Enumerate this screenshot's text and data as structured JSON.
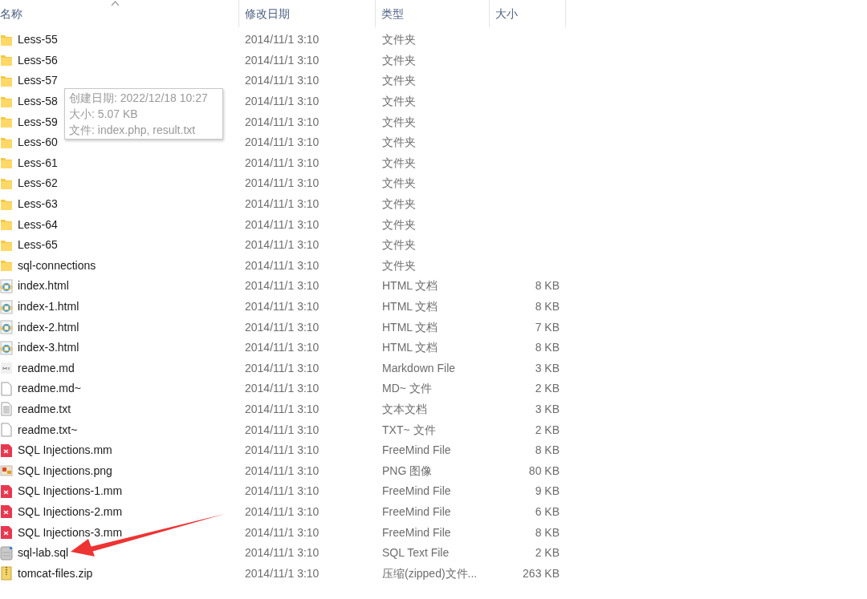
{
  "columns": [
    {
      "label": "名称",
      "sorted": true
    },
    {
      "label": "修改日期",
      "sorted": false
    },
    {
      "label": "类型",
      "sorted": false
    },
    {
      "label": "大小",
      "sorted": false
    }
  ],
  "rows": [
    {
      "kind": "folder",
      "name": "Less-55",
      "date": "2014/11/1 3:10",
      "type": "文件夹"
    },
    {
      "kind": "folder",
      "name": "Less-56",
      "date": "2014/11/1 3:10",
      "type": "文件夹"
    },
    {
      "kind": "folder",
      "name": "Less-57",
      "date": "2014/11/1 3:10",
      "type": "文件夹"
    },
    {
      "kind": "folder",
      "name": "Less-58",
      "date": "2014/11/1 3:10",
      "type": "文件夹"
    },
    {
      "kind": "folder",
      "name": "Less-59",
      "date": "2014/11/1 3:10",
      "type": "文件夹"
    },
    {
      "kind": "folder",
      "name": "Less-60",
      "date": "2014/11/1 3:10",
      "type": "文件夹"
    },
    {
      "kind": "folder",
      "name": "Less-61",
      "date": "2014/11/1 3:10",
      "type": "文件夹"
    },
    {
      "kind": "folder",
      "name": "Less-62",
      "date": "2014/11/1 3:10",
      "type": "文件夹"
    },
    {
      "kind": "folder",
      "name": "Less-63",
      "date": "2014/11/1 3:10",
      "type": "文件夹"
    },
    {
      "kind": "folder",
      "name": "Less-64",
      "date": "2014/11/1 3:10",
      "type": "文件夹"
    },
    {
      "kind": "folder",
      "name": "Less-65",
      "date": "2014/11/1 3:10",
      "type": "文件夹"
    },
    {
      "kind": "folder",
      "name": "sql-connections",
      "date": "2014/11/1 3:10",
      "type": "文件夹"
    },
    {
      "kind": "html",
      "name": "index.html",
      "date": "2014/11/1 3:10",
      "type": "HTML 文档",
      "size": "8 KB"
    },
    {
      "kind": "html",
      "name": "index-1.html",
      "date": "2014/11/1 3:10",
      "type": "HTML 文档",
      "size": "8 KB"
    },
    {
      "kind": "html",
      "name": "index-2.html",
      "date": "2014/11/1 3:10",
      "type": "HTML 文档",
      "size": "7 KB"
    },
    {
      "kind": "html",
      "name": "index-3.html",
      "date": "2014/11/1 3:10",
      "type": "HTML 文档",
      "size": "8 KB"
    },
    {
      "kind": "markdown",
      "name": "readme.md",
      "date": "2014/11/1 3:10",
      "type": "Markdown File",
      "size": "3 KB"
    },
    {
      "kind": "blank",
      "name": "readme.md~",
      "date": "2014/11/1 3:10",
      "type": "MD~ 文件",
      "size": "2 KB"
    },
    {
      "kind": "text",
      "name": "readme.txt",
      "date": "2014/11/1 3:10",
      "type": "文本文档",
      "size": "3 KB"
    },
    {
      "kind": "blank",
      "name": "readme.txt~",
      "date": "2014/11/1 3:10",
      "type": "TXT~ 文件",
      "size": "2 KB"
    },
    {
      "kind": "mindmap",
      "name": "SQL Injections.mm",
      "date": "2014/11/1 3:10",
      "type": "FreeMind File",
      "size": "8 KB"
    },
    {
      "kind": "image",
      "name": "SQL Injections.png",
      "date": "2014/11/1 3:10",
      "type": "PNG 图像",
      "size": "80 KB"
    },
    {
      "kind": "mindmap",
      "name": "SQL Injections-1.mm",
      "date": "2014/11/1 3:10",
      "type": "FreeMind File",
      "size": "9 KB"
    },
    {
      "kind": "mindmap",
      "name": "SQL Injections-2.mm",
      "date": "2014/11/1 3:10",
      "type": "FreeMind File",
      "size": "6 KB"
    },
    {
      "kind": "mindmap",
      "name": "SQL Injections-3.mm",
      "date": "2014/11/1 3:10",
      "type": "FreeMind File",
      "size": "8 KB"
    },
    {
      "kind": "sql",
      "name": "sql-lab.sql",
      "date": "2014/11/1 3:10",
      "type": "SQL Text File",
      "size": "2 KB"
    },
    {
      "kind": "zip",
      "name": "tomcat-files.zip",
      "date": "2014/11/1 3:10",
      "type": "压缩(zipped)文件...",
      "size": "263 KB"
    }
  ],
  "tooltip": {
    "lines": [
      "创建日期: 2022/12/18 10:27",
      "大小: 5.07 KB",
      "文件: index.php, result.txt"
    ]
  },
  "annotation": {
    "kind": "arrow"
  }
}
